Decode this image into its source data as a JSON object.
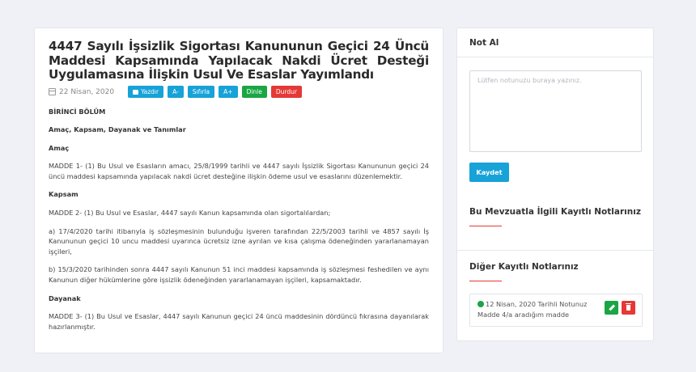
{
  "document": {
    "title": "4447 Sayılı İşsizlik Sigortası Kanununun Geçici 24 Üncü Maddesi Kapsamında Yapılacak Nakdi Ücret Desteği Uygulamasına İlişkin Usul Ve Esaslar Yayımlandı",
    "date": "22 Nisan, 2020",
    "buttons": {
      "print": "Yazdır",
      "font_decrease": "A-",
      "reset": "Sıfırla",
      "font_increase": "A+",
      "listen": "Dinle",
      "stop": "Durdur"
    },
    "section": "BİRİNCİ BÖLÜM",
    "section_title": "Amaç, Kapsam, Dayanak ve Tanımlar",
    "h_amac": "Amaç",
    "p_madde1": "MADDE 1- (1) Bu Usul ve Esasların amacı, 25/8/1999 tarihli ve 4447 sayılı İşsizlik Sigortası Kanununun geçici 24 üncü maddesi kapsamında yapılacak nakdi ücret desteğine ilişkin ödeme usul ve esaslarını düzenlemektir.",
    "h_kapsam": "Kapsam",
    "p_madde2": "MADDE 2- (1) Bu Usul ve Esaslar, 4447 sayılı Kanun kapsamında olan sigortalılardan;",
    "p_a": "a) 17/4/2020 tarihi itibarıyla iş sözleşmesinin bulunduğu işveren tarafından 22/5/2003 tarihli ve 4857 sayılı İş Kanununun geçici 10 uncu maddesi uyarınca ücretsiz izne ayrılan ve kısa çalışma ödeneğinden yararlanamayan işçileri,",
    "p_b": "b) 15/3/2020 tarihinden sonra 4447 sayılı Kanunun 51 inci maddesi kapsamında iş sözleşmesi feshedilen ve aynı Kanunun diğer hükümlerine göre işsizlik ödeneğinden yararlanamayan işçileri, kapsamaktadır.",
    "h_dayanak": "Dayanak",
    "p_madde3": "MADDE 3- (1) Bu Usul ve Esaslar, 4447 sayılı Kanunun geçici 24 üncü maddesinin dördüncü fıkrasına dayanılarak hazırlanmıştır."
  },
  "sidebar": {
    "header": "Not Al",
    "note_placeholder": "Lütfen notunuzu buraya yazınız.",
    "save_label": "Kaydet",
    "related_title": "Bu Mevzuatla İlgili Kayıtlı Notlarınız",
    "other_title": "Diğer Kayıtlı Notlarınız",
    "notes": [
      {
        "text": "12 Nisan, 2020 Tarihli Notunuz Madde 4/a aradığım madde"
      }
    ]
  },
  "colors": {
    "accent_blue": "#17a2d8",
    "green": "#1aa643",
    "red": "#e53935"
  },
  "icons": [
    "calendar-icon",
    "printer-icon",
    "check-circle-icon",
    "pencil-icon",
    "trash-icon"
  ]
}
